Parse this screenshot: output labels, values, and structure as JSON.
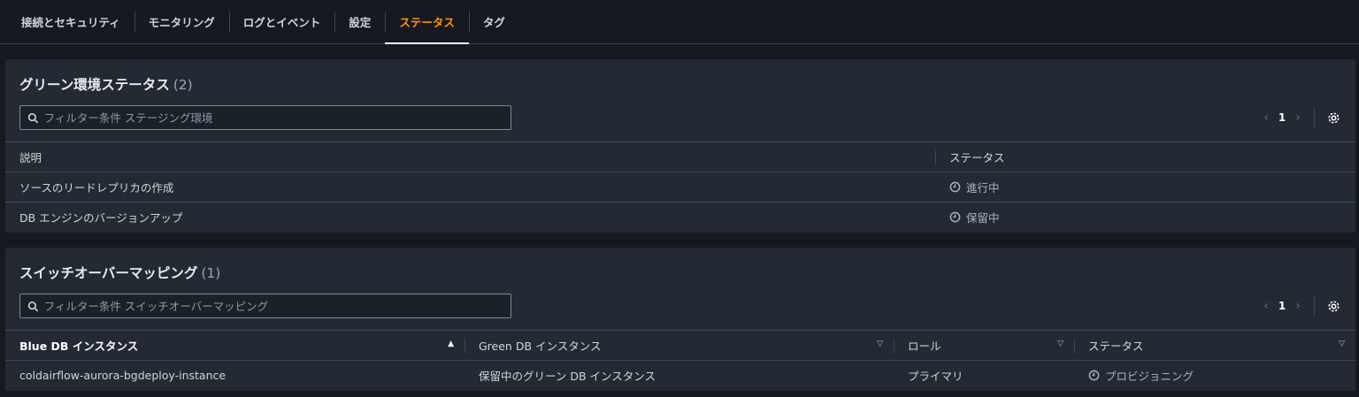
{
  "tabs": [
    {
      "label": "接続とセキュリティ",
      "active": false
    },
    {
      "label": "モニタリング",
      "active": false
    },
    {
      "label": "ログとイベント",
      "active": false
    },
    {
      "label": "設定",
      "active": false
    },
    {
      "label": "ステータス",
      "active": true
    },
    {
      "label": "タグ",
      "active": false
    }
  ],
  "green_env": {
    "title": "グリーン環境ステータス",
    "count": "(2)",
    "filter_placeholder": "フィルター条件 ステージング環境",
    "page": "1",
    "columns": [
      "説明",
      "ステータス"
    ],
    "rows": [
      {
        "description": "ソースのリードレプリカの作成",
        "status": "進行中",
        "status_icon": "clock-icon"
      },
      {
        "description": "DB エンジンのバージョンアップ",
        "status": "保留中",
        "status_icon": "clock-icon"
      }
    ]
  },
  "switchover": {
    "title": "スイッチオーバーマッピング",
    "count": "(1)",
    "filter_placeholder": "フィルター条件 スイッチオーバーマッピング",
    "page": "1",
    "columns": [
      "Blue DB インスタンス",
      "Green DB インスタンス",
      "ロール",
      "ステータス"
    ],
    "rows": [
      {
        "blue": "coldairflow-aurora-bgdeploy-instance",
        "green": "保留中のグリーン DB インスタンス",
        "role": "プライマリ",
        "status": "プロビジョニング",
        "status_icon": "clock-icon"
      }
    ]
  },
  "colors": {
    "accent": "#ff9900",
    "background": "#16191f",
    "panel": "#232a33",
    "border": "#414750"
  }
}
